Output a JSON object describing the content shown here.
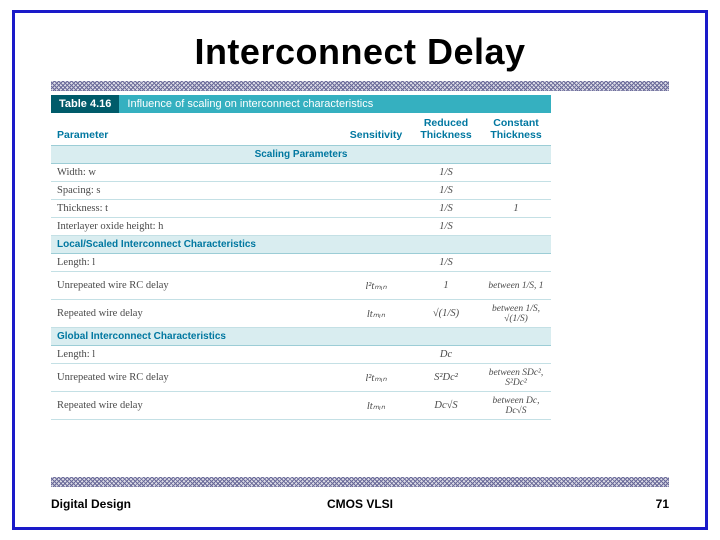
{
  "title": "Interconnect Delay",
  "footer": {
    "left": "Digital Design",
    "center": "CMOS VLSI",
    "right": "71"
  },
  "table": {
    "number": "Table 4.16",
    "caption": "Influence of scaling on interconnect characteristics",
    "headers": {
      "parameter": "Parameter",
      "sensitivity": "Sensitivity",
      "reduced": "Reduced Thickness",
      "constant": "Constant Thickness"
    },
    "sections": {
      "scaling": "Scaling Parameters",
      "local": "Local/Scaled Interconnect Characteristics",
      "global": "Global Interconnect Characteristics"
    },
    "rows": {
      "width": {
        "param": "Width: w",
        "sens": "",
        "red": "1/S",
        "con": ""
      },
      "spacing": {
        "param": "Spacing: s",
        "sens": "",
        "red": "1/S",
        "con": ""
      },
      "thickness": {
        "param": "Thickness: t",
        "sens": "",
        "red": "1/S",
        "con": "1"
      },
      "oxide": {
        "param": "Interlayer oxide height: h",
        "sens": "",
        "red": "1/S",
        "con": ""
      },
      "length_l": {
        "param": "Length: l",
        "sens": "",
        "red": "1/S",
        "con": ""
      },
      "unrep_l": {
        "param": "Unrepeated wire RC delay",
        "sens": "l²tₘᵢₙ",
        "red": "1",
        "con": "between 1/S, 1"
      },
      "rep_l": {
        "param": "Repeated wire delay",
        "sens": "ltₘᵢₙ",
        "red": "√(1/S)",
        "con": "between 1/S, √(1/S)"
      },
      "length_g": {
        "param": "Length: l",
        "sens": "",
        "red": "Dc",
        "con": ""
      },
      "unrep_g": {
        "param": "Unrepeated wire RC delay",
        "sens": "l²tₘᵢₙ",
        "red": "S²Dc²",
        "con": "between SDc², S²Dc²"
      },
      "rep_g": {
        "param": "Repeated wire delay",
        "sens": "ltₘᵢₙ",
        "red": "Dc√S",
        "con": "between Dc, Dc√S"
      }
    }
  }
}
